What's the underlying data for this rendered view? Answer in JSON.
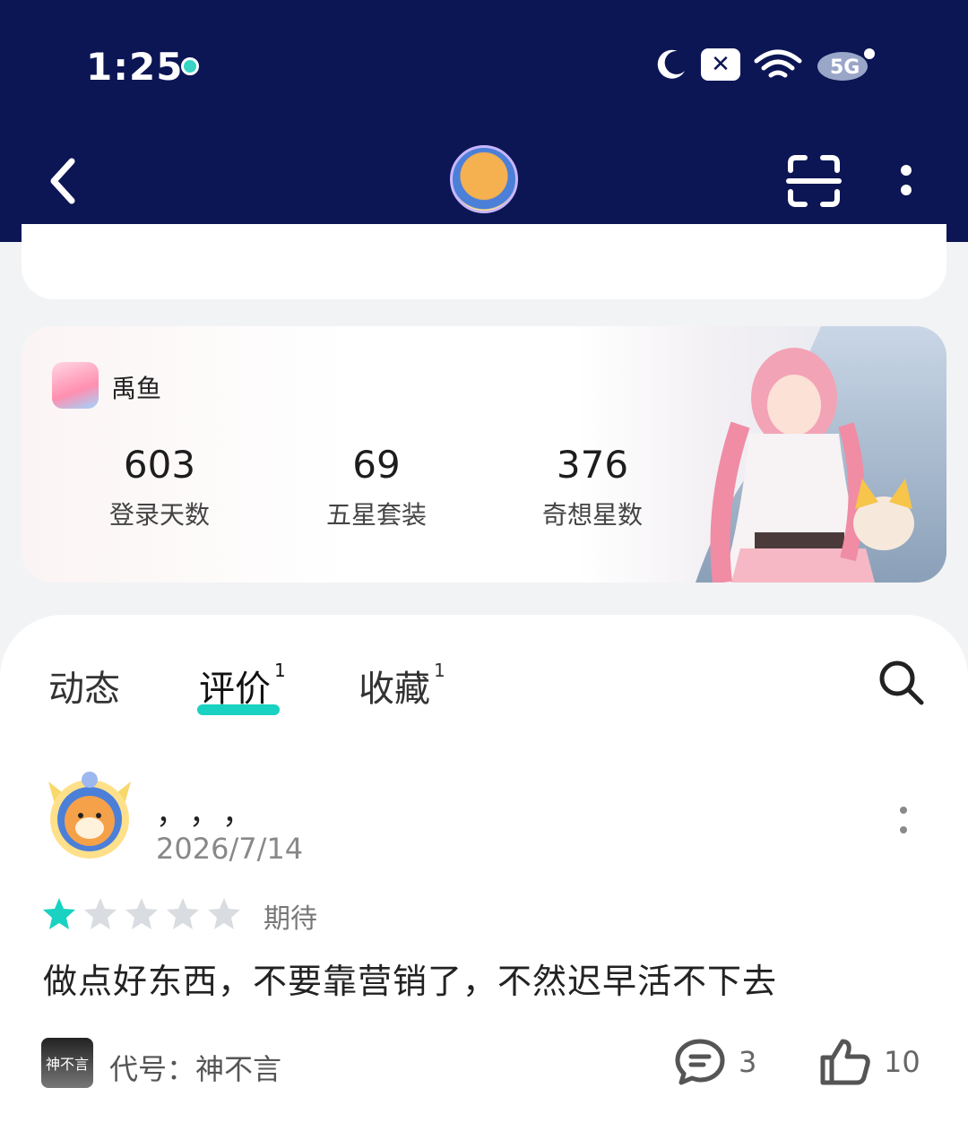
{
  "status": {
    "time": "1:25",
    "signal_text": "5G"
  },
  "game": {
    "name": "禹鱼",
    "stats": [
      {
        "value": "603",
        "label": "登录天数"
      },
      {
        "value": "69",
        "label": "五星套装"
      },
      {
        "value": "376",
        "label": "奇想星数"
      }
    ]
  },
  "tabs": [
    {
      "label": "动态",
      "count": ""
    },
    {
      "label": "评价",
      "count": "1"
    },
    {
      "label": "收藏",
      "count": "1"
    }
  ],
  "review": {
    "user_name": "，，，",
    "date": "2026/7/14",
    "rating": 1,
    "rating_max": 5,
    "rating_label": "期待",
    "text": "做点好东西，不要靠营销了，不然迟早活不下去",
    "game_tag": "代号：神不言",
    "game_tag_icon_text": "神不言",
    "comments": "3",
    "likes": "10"
  },
  "colors": {
    "header_bg": "#0c1655",
    "accent": "#19d2c1",
    "star_empty": "#d9dce1"
  }
}
